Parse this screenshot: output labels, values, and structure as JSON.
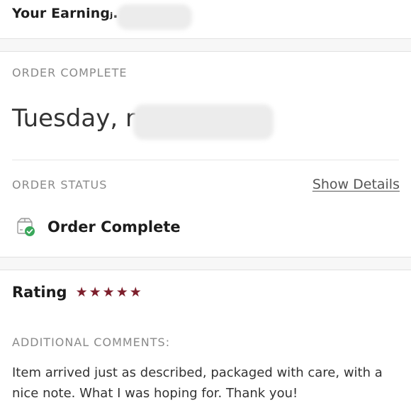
{
  "earnings": {
    "label": "Your Earningⱼ."
  },
  "order_complete": {
    "caption": "ORDER COMPLETE",
    "date": "Tuesday, r"
  },
  "order_status": {
    "caption": "ORDER STATUS",
    "show_details_label": "Show Details",
    "status_text": "Order Complete",
    "status_icon": "box-check-icon",
    "check_color": "#3aa85b"
  },
  "rating": {
    "label": "Rating",
    "stars": 5,
    "max_stars": 5,
    "star_color": "#7d1f2c"
  },
  "comments": {
    "caption": "ADDITIONAL COMMENTS:",
    "text": "Item arrived just as described, packaged with care, with a nice note. What I was hoping for. Thank you!"
  }
}
